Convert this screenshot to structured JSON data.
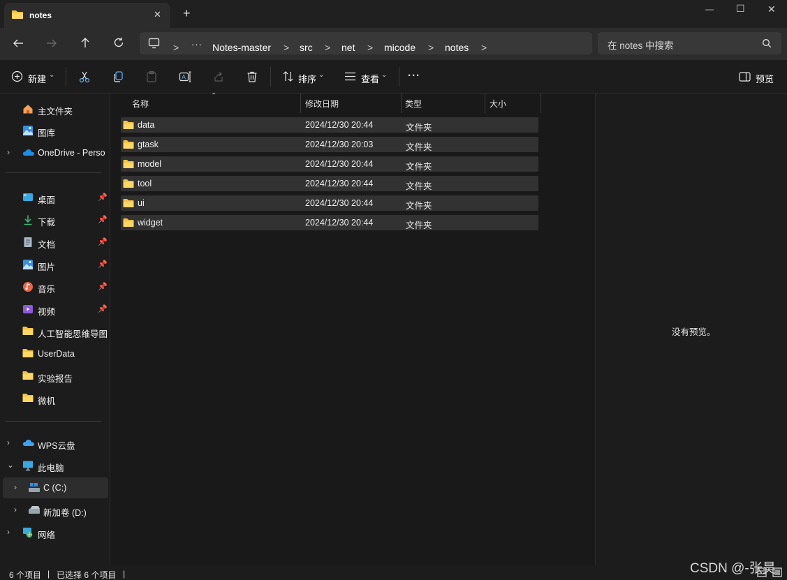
{
  "tab": {
    "title": "notes",
    "close": "✕",
    "new_tab": "+"
  },
  "window_controls": {
    "minimize": "—",
    "maximize": "☐",
    "close": "✕"
  },
  "nav": {
    "more": "···",
    "breadcrumbs": [
      "Notes-master",
      "src",
      "net",
      "micode",
      "notes"
    ],
    "search_placeholder": "在 notes 中搜索"
  },
  "toolbar": {
    "new_label": "新建",
    "sort_label": "排序",
    "view_label": "查看",
    "more_label": "···",
    "preview_label": "预览"
  },
  "sidebar": {
    "top": [
      {
        "label": "主文件夹",
        "icon": "home-icon"
      },
      {
        "label": "图库",
        "icon": "gallery-icon"
      },
      {
        "label": "OneDrive - Perso",
        "icon": "onedrive-icon"
      }
    ],
    "quick": [
      {
        "label": "桌面",
        "icon": "desktop-icon"
      },
      {
        "label": "下载",
        "icon": "download-icon"
      },
      {
        "label": "文档",
        "icon": "documents-icon"
      },
      {
        "label": "图片",
        "icon": "pictures-icon"
      },
      {
        "label": "音乐",
        "icon": "music-icon"
      },
      {
        "label": "视频",
        "icon": "video-icon"
      },
      {
        "label": "人工智能思维导图",
        "icon": "folder-icon"
      },
      {
        "label": "UserData",
        "icon": "folder-icon"
      },
      {
        "label": "实验报告",
        "icon": "folder-icon"
      },
      {
        "label": "微机",
        "icon": "folder-icon"
      }
    ],
    "devices": [
      {
        "label": "WPS云盘",
        "icon": "wps-cloud-icon"
      },
      {
        "label": "此电脑",
        "icon": "this-pc-icon"
      },
      {
        "label": "C (C:)",
        "icon": "drive-c-icon"
      },
      {
        "label": "新加卷 (D:)",
        "icon": "drive-d-icon"
      },
      {
        "label": "网络",
        "icon": "network-icon"
      }
    ]
  },
  "columns": {
    "name": "名称",
    "modified": "修改日期",
    "type": "类型",
    "size": "大小"
  },
  "files": [
    {
      "name": "data",
      "modified": "2024/12/30 20:44",
      "type": "文件夹"
    },
    {
      "name": "gtask",
      "modified": "2024/12/30 20:03",
      "type": "文件夹"
    },
    {
      "name": "model",
      "modified": "2024/12/30 20:44",
      "type": "文件夹"
    },
    {
      "name": "tool",
      "modified": "2024/12/30 20:44",
      "type": "文件夹"
    },
    {
      "name": "ui",
      "modified": "2024/12/30 20:44",
      "type": "文件夹"
    },
    {
      "name": "widget",
      "modified": "2024/12/30 20:44",
      "type": "文件夹"
    }
  ],
  "preview_pane": {
    "empty_text": "没有预览。"
  },
  "status": {
    "item_count": "6 个项目",
    "selected": "已选择 6 个项目",
    "separator": "|"
  },
  "watermark": "CSDN @-张昊"
}
